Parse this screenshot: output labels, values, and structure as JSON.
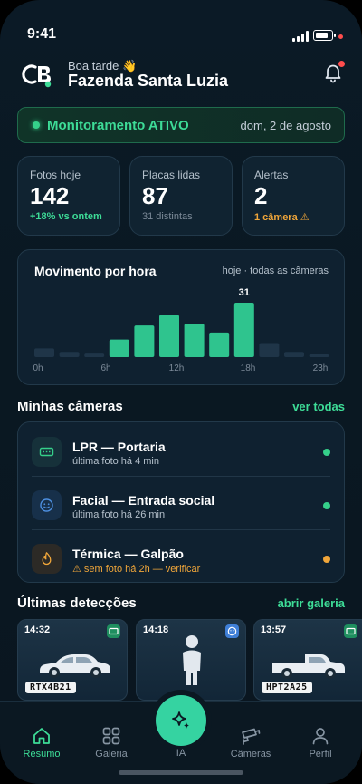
{
  "status_bar": {
    "time": "9:41"
  },
  "header": {
    "greeting": "Boa tarde 👋",
    "farm_name": "Fazenda Santa Luzia"
  },
  "monitoring": {
    "label": "Monitoramento ATIVO",
    "date": "dom, 2 de agosto"
  },
  "stats": [
    {
      "label": "Fotos hoje",
      "value": "142",
      "sub": "+18% vs ontem"
    },
    {
      "label": "Placas lidas",
      "value": "87",
      "sub": "31 distintas"
    },
    {
      "label": "Alertas",
      "value": "2",
      "sub": "1 câmera ⚠"
    }
  ],
  "chart_data": {
    "type": "bar",
    "title": "Movimento por hora",
    "subtitle": "hoje · todas as câmeras",
    "categories": [
      "0h",
      "2h",
      "4h",
      "6h",
      "8h",
      "10h",
      "12h",
      "14h",
      "16h",
      "18h",
      "20h",
      "22h",
      "23h"
    ],
    "tick_labels": [
      "0h",
      "6h",
      "12h",
      "18h",
      "23h"
    ],
    "values": [
      5,
      3,
      2,
      10,
      18,
      24,
      19,
      14,
      31,
      8,
      3,
      1
    ],
    "peak_label": "31",
    "colors": {
      "active": "#2fc48e",
      "inactive": "#1f3548"
    }
  },
  "cameras_section": {
    "title": "Minhas câmeras",
    "link": "ver todas"
  },
  "cameras": [
    {
      "name": "LPR — Portaria",
      "sub": "última foto há 4 min",
      "icon": "license-plate-icon",
      "status_color": "#35d08a"
    },
    {
      "name": "Facial — Entrada social",
      "sub": "última foto há 26 min",
      "icon": "face-icon",
      "status_color": "#35d08a"
    },
    {
      "name": "Térmica — Galpão",
      "sub": "⚠ sem foto há 2h — verificar",
      "icon": "flame-icon",
      "status_color": "#f0a63a"
    }
  ],
  "detections_section": {
    "title": "Últimas detecções",
    "link": "abrir galeria"
  },
  "detections": [
    {
      "time": "14:32",
      "kind": "car",
      "plate": "RTX4B21",
      "badge": "license-plate-icon"
    },
    {
      "time": "14:18",
      "kind": "person",
      "badge": "face-icon"
    },
    {
      "time": "13:57",
      "kind": "pickup",
      "plate": "HPT2A25",
      "badge": "license-plate-icon"
    }
  ],
  "tabbar": {
    "items": [
      {
        "label": "Resumo",
        "icon": "home-icon",
        "active": true
      },
      {
        "label": "Galeria",
        "icon": "grid-icon",
        "active": false
      },
      {
        "label": "IA",
        "icon": "sparkle-icon",
        "active": false
      },
      {
        "label": "Câmeras",
        "icon": "camera-icon",
        "active": false
      },
      {
        "label": "Perfil",
        "icon": "user-icon",
        "active": false
      }
    ]
  }
}
